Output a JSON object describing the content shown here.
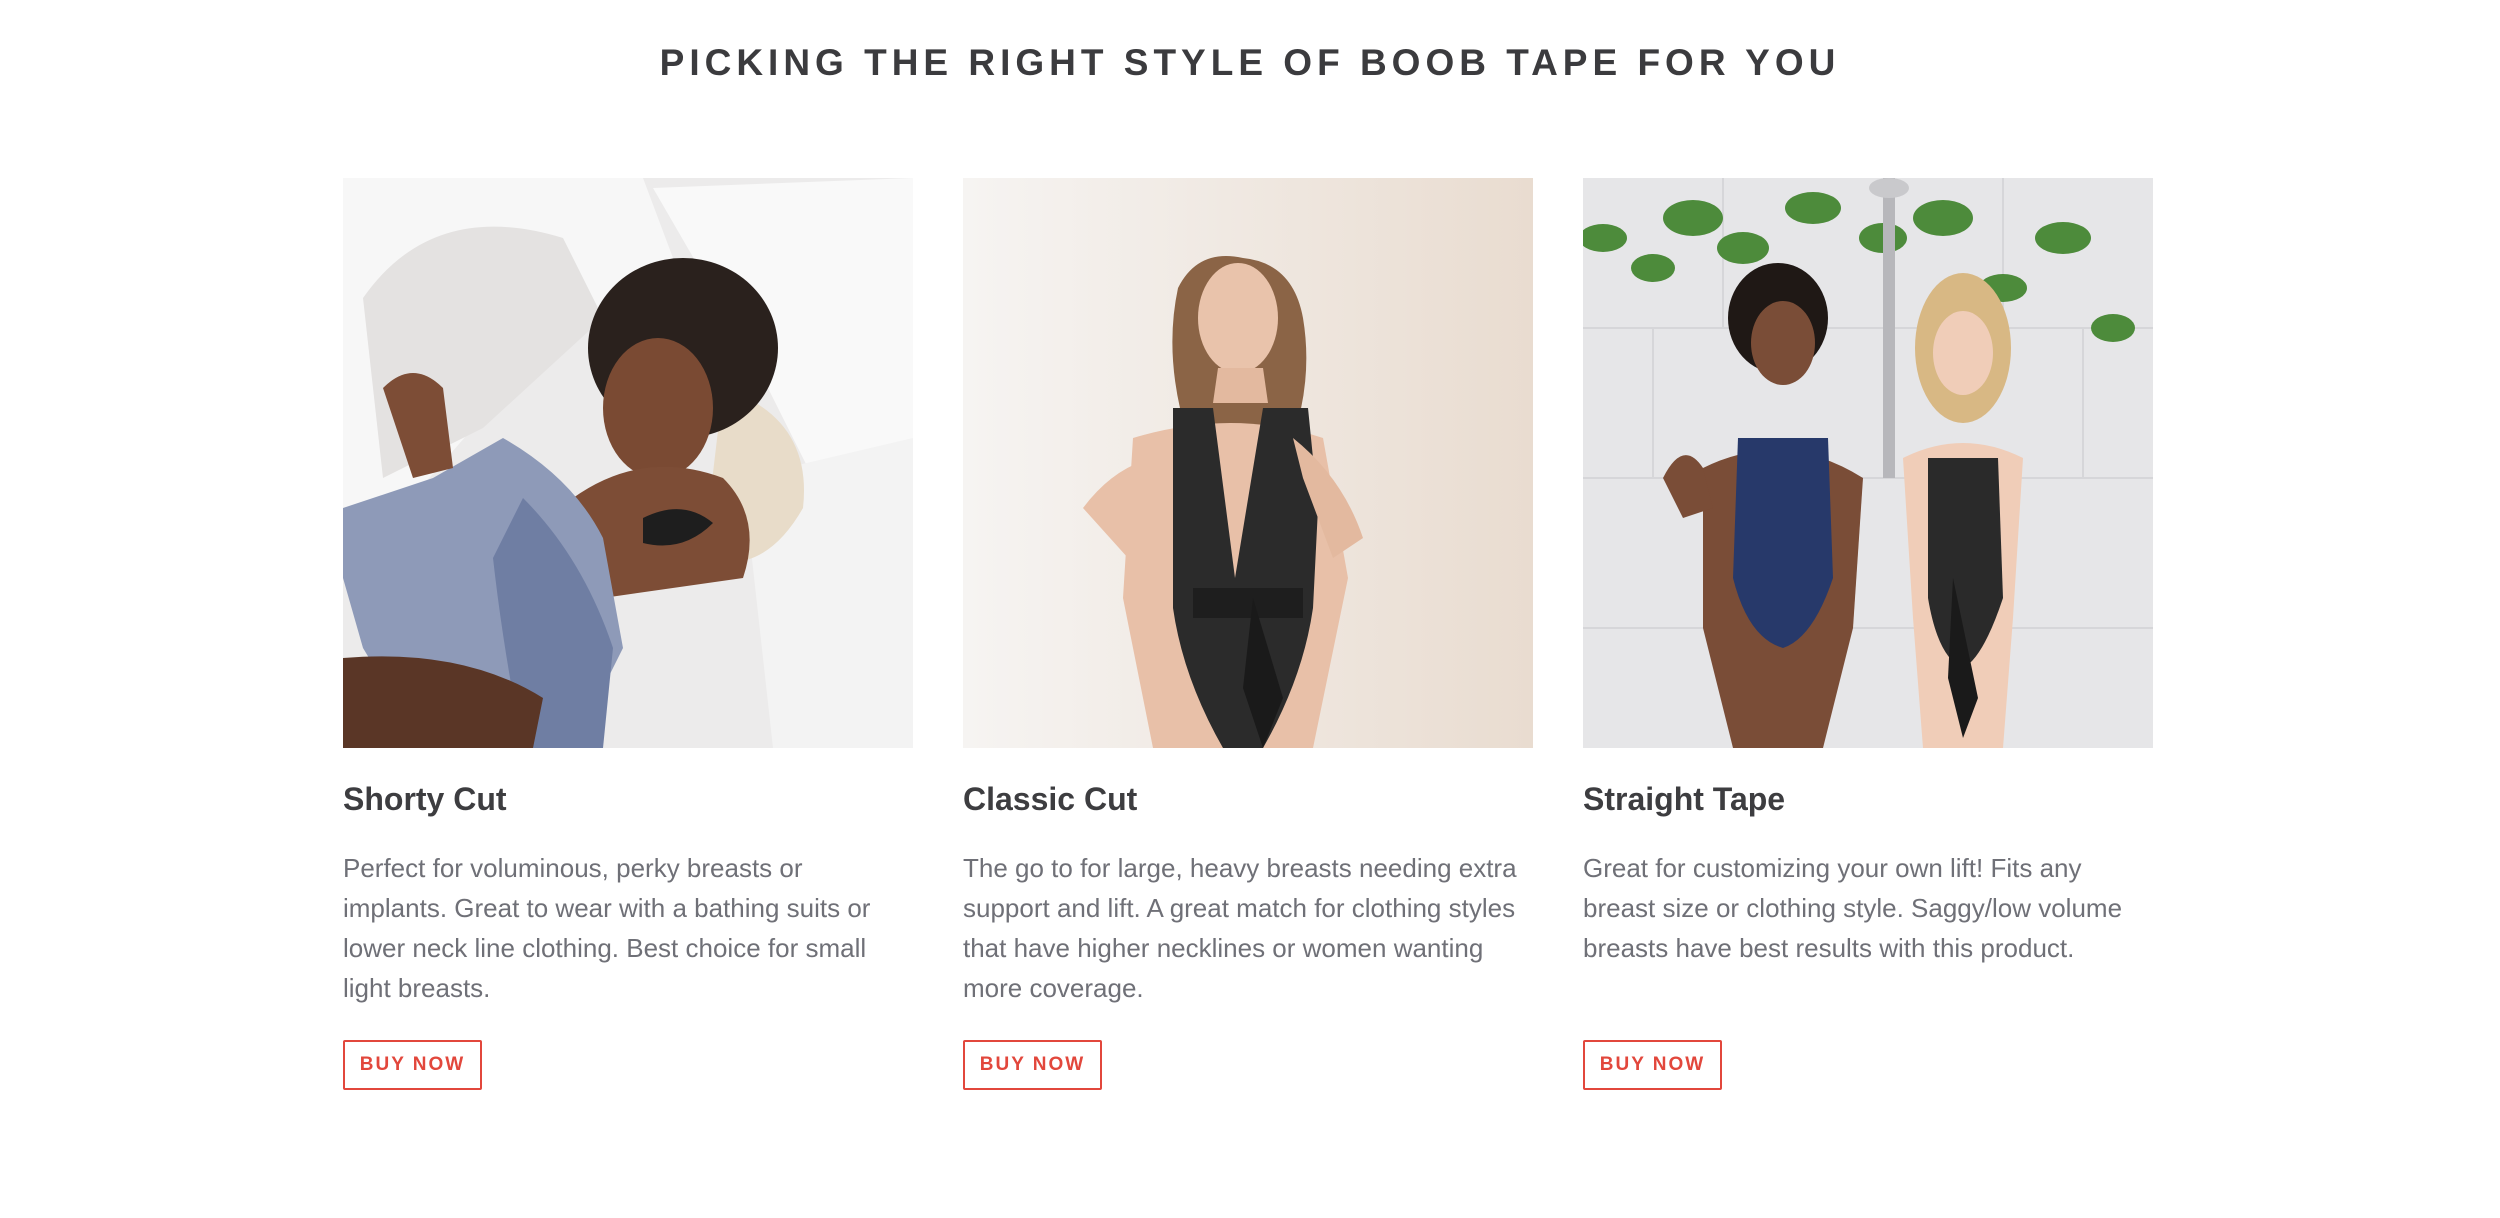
{
  "section": {
    "title": "PICKING THE RIGHT STYLE OF BOOB TAPE FOR YOU"
  },
  "cards": [
    {
      "title": "Shorty Cut",
      "description": "Perfect for voluminous, perky breasts or implants. Great to wear with a bathing suits or lower neck line clothing. Best choice for small light breasts.",
      "button": "BUY NOW",
      "image_alt": "Woman lying on white pillows wearing a black strapless bra and blue patterned robe"
    },
    {
      "title": "Classic Cut",
      "description": "The go to for large, heavy breasts needing extra support and lift. A great match for clothing styles that have higher necklines or women wanting more coverage.",
      "button": "BUY NOW",
      "image_alt": "Woman in a black plunging bodysuit against a cream wall"
    },
    {
      "title": "Straight Tape",
      "description": "Great for customizing your own lift! Fits any breast size or clothing style. Saggy/low volume breasts have best results with this product.",
      "button": "BUY NOW",
      "image_alt": "Two women laughing in a marble shower with hanging plants, wearing blue and black swimsuits"
    }
  ],
  "colors": {
    "title": "#3b3b3e",
    "text": "#6f7077",
    "accent": "#e2473c"
  }
}
